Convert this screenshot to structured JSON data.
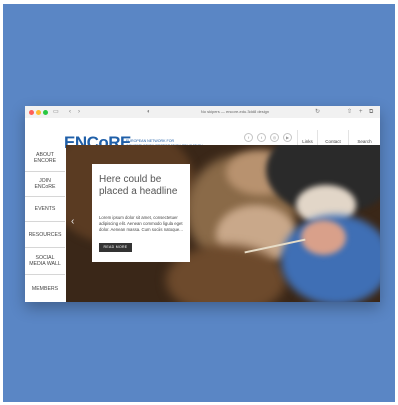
{
  "browser": {
    "url_text": "No skipers — encore-edu.3dd8 design",
    "icons": [
      "sidebar-icon",
      "back-icon",
      "forward-icon",
      "shield-icon",
      "reload-icon",
      "share-icon",
      "new-tab-icon",
      "tabs-icon"
    ]
  },
  "site": {
    "logo": "ENCoRE",
    "tagline_line1": "EUROPEAN NETWORK FOR",
    "tagline_line2": "CONSERVATION-RESTORATION EDUCATION"
  },
  "social_icons": [
    "facebook-icon",
    "twitter-icon",
    "instagram-icon",
    "youtube-icon"
  ],
  "top_buttons": [
    "Links",
    "Contact",
    "Search"
  ],
  "nav": [
    {
      "line1": "ABOUT",
      "line2": "ENCORE"
    },
    {
      "line1": "JOIN",
      "line2": "ENCoRE"
    },
    {
      "line1": "EVENTS",
      "line2": ""
    },
    {
      "line1": "RESOURCES",
      "line2": ""
    },
    {
      "line1": "SOCIAL",
      "line2": "MEDIA WALL"
    },
    {
      "line1": "MEMBERS",
      "line2": ""
    }
  ],
  "hero": {
    "headline": "Here could be placed a headline",
    "body": "Lorem ipsum dolor sit amet, consectetuer adipiscing elit. Aenean commodo ligula eget dolor. Aenean massa. Cum sociis natoque...",
    "button": "READ MORE",
    "prev_arrow": "‹"
  },
  "colors": {
    "background": "#5a86c5",
    "brand_blue": "#1f5fa8",
    "button_dark": "#333333"
  }
}
